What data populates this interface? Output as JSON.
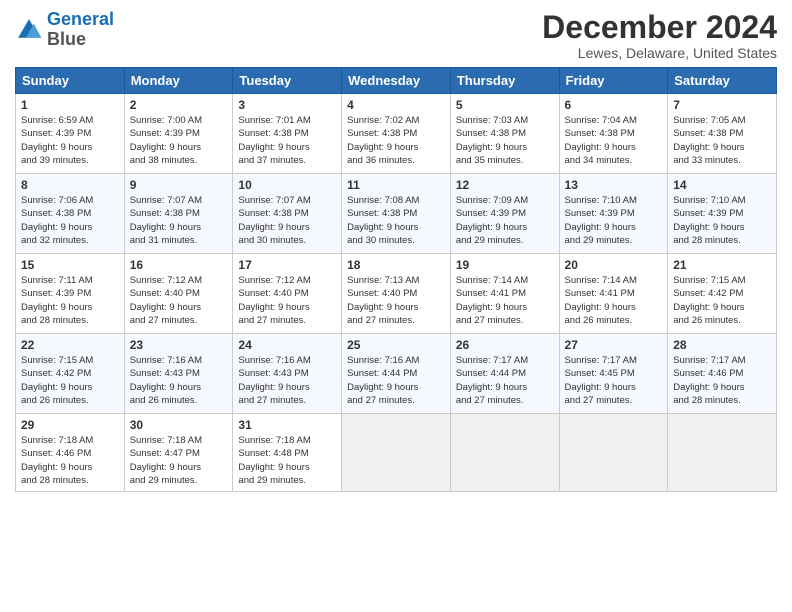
{
  "logo": {
    "line1": "General",
    "line2": "Blue"
  },
  "title": "December 2024",
  "subtitle": "Lewes, Delaware, United States",
  "headers": [
    "Sunday",
    "Monday",
    "Tuesday",
    "Wednesday",
    "Thursday",
    "Friday",
    "Saturday"
  ],
  "weeks": [
    [
      {
        "day": "1",
        "info": "Sunrise: 6:59 AM\nSunset: 4:39 PM\nDaylight: 9 hours\nand 39 minutes."
      },
      {
        "day": "2",
        "info": "Sunrise: 7:00 AM\nSunset: 4:39 PM\nDaylight: 9 hours\nand 38 minutes."
      },
      {
        "day": "3",
        "info": "Sunrise: 7:01 AM\nSunset: 4:38 PM\nDaylight: 9 hours\nand 37 minutes."
      },
      {
        "day": "4",
        "info": "Sunrise: 7:02 AM\nSunset: 4:38 PM\nDaylight: 9 hours\nand 36 minutes."
      },
      {
        "day": "5",
        "info": "Sunrise: 7:03 AM\nSunset: 4:38 PM\nDaylight: 9 hours\nand 35 minutes."
      },
      {
        "day": "6",
        "info": "Sunrise: 7:04 AM\nSunset: 4:38 PM\nDaylight: 9 hours\nand 34 minutes."
      },
      {
        "day": "7",
        "info": "Sunrise: 7:05 AM\nSunset: 4:38 PM\nDaylight: 9 hours\nand 33 minutes."
      }
    ],
    [
      {
        "day": "8",
        "info": "Sunrise: 7:06 AM\nSunset: 4:38 PM\nDaylight: 9 hours\nand 32 minutes."
      },
      {
        "day": "9",
        "info": "Sunrise: 7:07 AM\nSunset: 4:38 PM\nDaylight: 9 hours\nand 31 minutes."
      },
      {
        "day": "10",
        "info": "Sunrise: 7:07 AM\nSunset: 4:38 PM\nDaylight: 9 hours\nand 30 minutes."
      },
      {
        "day": "11",
        "info": "Sunrise: 7:08 AM\nSunset: 4:38 PM\nDaylight: 9 hours\nand 30 minutes."
      },
      {
        "day": "12",
        "info": "Sunrise: 7:09 AM\nSunset: 4:39 PM\nDaylight: 9 hours\nand 29 minutes."
      },
      {
        "day": "13",
        "info": "Sunrise: 7:10 AM\nSunset: 4:39 PM\nDaylight: 9 hours\nand 29 minutes."
      },
      {
        "day": "14",
        "info": "Sunrise: 7:10 AM\nSunset: 4:39 PM\nDaylight: 9 hours\nand 28 minutes."
      }
    ],
    [
      {
        "day": "15",
        "info": "Sunrise: 7:11 AM\nSunset: 4:39 PM\nDaylight: 9 hours\nand 28 minutes."
      },
      {
        "day": "16",
        "info": "Sunrise: 7:12 AM\nSunset: 4:40 PM\nDaylight: 9 hours\nand 27 minutes."
      },
      {
        "day": "17",
        "info": "Sunrise: 7:12 AM\nSunset: 4:40 PM\nDaylight: 9 hours\nand 27 minutes."
      },
      {
        "day": "18",
        "info": "Sunrise: 7:13 AM\nSunset: 4:40 PM\nDaylight: 9 hours\nand 27 minutes."
      },
      {
        "day": "19",
        "info": "Sunrise: 7:14 AM\nSunset: 4:41 PM\nDaylight: 9 hours\nand 27 minutes."
      },
      {
        "day": "20",
        "info": "Sunrise: 7:14 AM\nSunset: 4:41 PM\nDaylight: 9 hours\nand 26 minutes."
      },
      {
        "day": "21",
        "info": "Sunrise: 7:15 AM\nSunset: 4:42 PM\nDaylight: 9 hours\nand 26 minutes."
      }
    ],
    [
      {
        "day": "22",
        "info": "Sunrise: 7:15 AM\nSunset: 4:42 PM\nDaylight: 9 hours\nand 26 minutes."
      },
      {
        "day": "23",
        "info": "Sunrise: 7:16 AM\nSunset: 4:43 PM\nDaylight: 9 hours\nand 26 minutes."
      },
      {
        "day": "24",
        "info": "Sunrise: 7:16 AM\nSunset: 4:43 PM\nDaylight: 9 hours\nand 27 minutes."
      },
      {
        "day": "25",
        "info": "Sunrise: 7:16 AM\nSunset: 4:44 PM\nDaylight: 9 hours\nand 27 minutes."
      },
      {
        "day": "26",
        "info": "Sunrise: 7:17 AM\nSunset: 4:44 PM\nDaylight: 9 hours\nand 27 minutes."
      },
      {
        "day": "27",
        "info": "Sunrise: 7:17 AM\nSunset: 4:45 PM\nDaylight: 9 hours\nand 27 minutes."
      },
      {
        "day": "28",
        "info": "Sunrise: 7:17 AM\nSunset: 4:46 PM\nDaylight: 9 hours\nand 28 minutes."
      }
    ],
    [
      {
        "day": "29",
        "info": "Sunrise: 7:18 AM\nSunset: 4:46 PM\nDaylight: 9 hours\nand 28 minutes."
      },
      {
        "day": "30",
        "info": "Sunrise: 7:18 AM\nSunset: 4:47 PM\nDaylight: 9 hours\nand 29 minutes."
      },
      {
        "day": "31",
        "info": "Sunrise: 7:18 AM\nSunset: 4:48 PM\nDaylight: 9 hours\nand 29 minutes."
      },
      {
        "day": "",
        "info": ""
      },
      {
        "day": "",
        "info": ""
      },
      {
        "day": "",
        "info": ""
      },
      {
        "day": "",
        "info": ""
      }
    ]
  ]
}
